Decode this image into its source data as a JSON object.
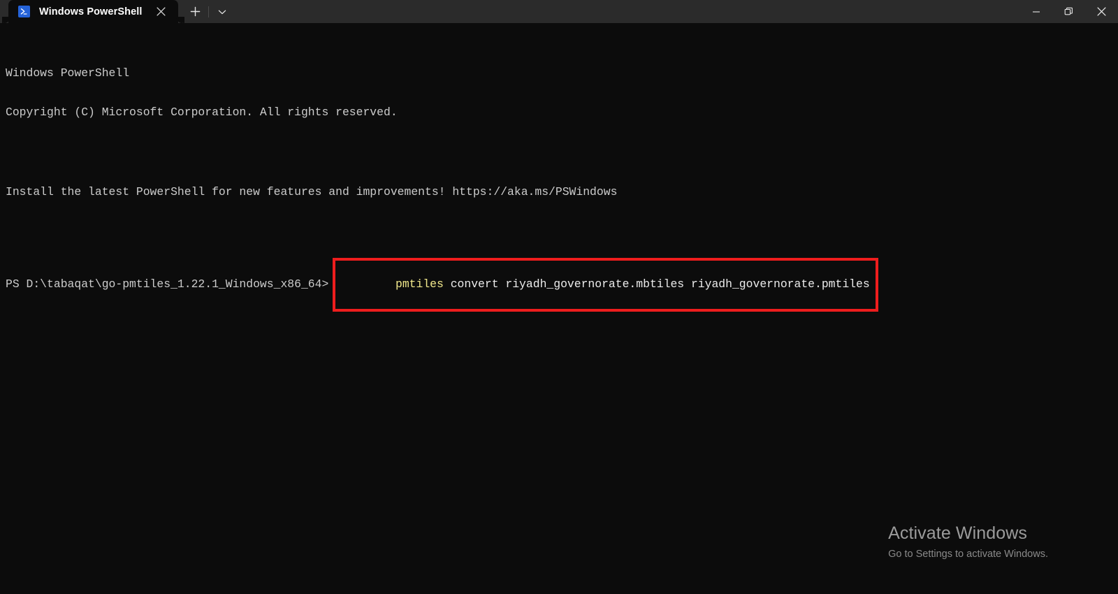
{
  "window": {
    "titlebar_bg": "#2b2b2b",
    "terminal_bg": "#0c0c0c",
    "tab": {
      "icon": "powershell-icon",
      "title": "Windows PowerShell",
      "close_label": "✕"
    },
    "new_tab_label": "+",
    "dropdown_label": "˅",
    "controls": {
      "minimize": "─",
      "maximize": "restore-icon",
      "close": "✕"
    }
  },
  "terminal": {
    "lines": [
      {
        "text": "Windows PowerShell",
        "kind": "text"
      },
      {
        "text": "Copyright (C) Microsoft Corporation. All rights reserved.",
        "kind": "text"
      },
      {
        "text": "",
        "kind": "blank"
      },
      {
        "text": "Install the latest PowerShell for new features and improvements! https://aka.ms/PSWindows",
        "kind": "text"
      },
      {
        "text": "",
        "kind": "blank"
      }
    ],
    "prompt": "PS D:\\tabaqat\\go-pmtiles_1.22.1_Windows_x86_64>",
    "command": {
      "program": "pmtiles",
      "arguments": " convert riyadh_governorate.mbtiles riyadh_governorate.pmtiles",
      "program_color": "#f2e98c",
      "arguments_color": "#ececec",
      "highlight_color": "#ee1d1d"
    }
  },
  "watermark": {
    "title": "Activate Windows",
    "subtitle": "Go to Settings to activate Windows."
  }
}
